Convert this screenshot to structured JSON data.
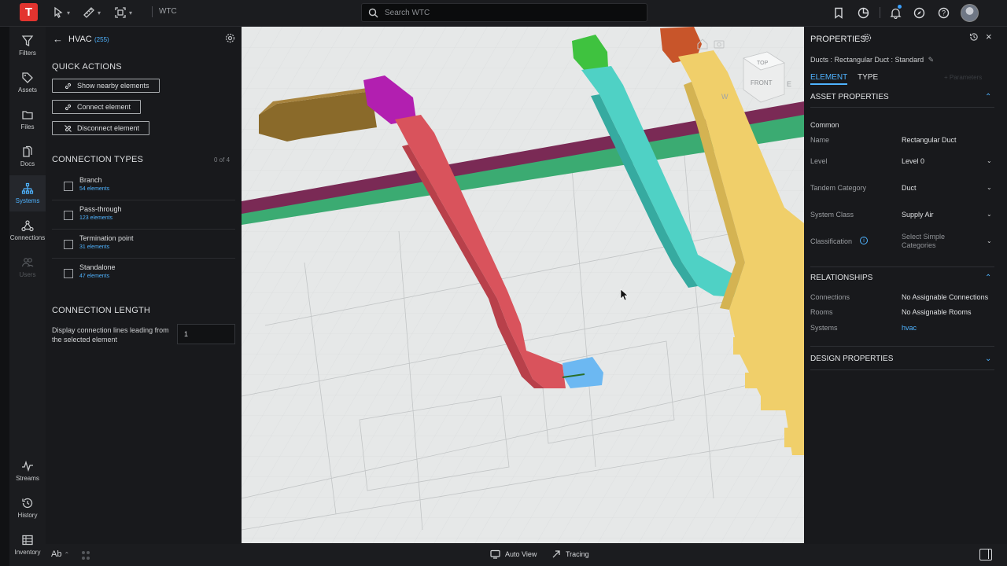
{
  "topbar": {
    "logo": "T",
    "project": "WTC",
    "search_placeholder": "Search WTC"
  },
  "rail": {
    "items": [
      {
        "label": "Filters",
        "icon": "filter-icon"
      },
      {
        "label": "Assets",
        "icon": "tag-icon"
      },
      {
        "label": "Files",
        "icon": "folder-icon"
      },
      {
        "label": "Docs",
        "icon": "docs-icon"
      },
      {
        "label": "Systems",
        "icon": "systems-icon"
      },
      {
        "label": "Connections",
        "icon": "connections-icon"
      },
      {
        "label": "Users",
        "icon": "users-icon"
      }
    ],
    "bottom": [
      {
        "label": "Streams",
        "icon": "streams-icon"
      },
      {
        "label": "History",
        "icon": "history-icon"
      },
      {
        "label": "Inventory",
        "icon": "inventory-icon"
      }
    ]
  },
  "left_panel": {
    "title": "HVAC",
    "count": "(255)",
    "quick_actions_title": "QUICK ACTIONS",
    "quick_actions": [
      "Show nearby elements",
      "Connect element",
      "Disconnect element"
    ],
    "connection_types_title": "CONNECTION TYPES",
    "connection_types_count": "0 of 4",
    "connection_types": [
      {
        "name": "Branch",
        "count": "54 elements"
      },
      {
        "name": "Pass-through",
        "count": "123 elements"
      },
      {
        "name": "Termination point",
        "count": "31 elements"
      },
      {
        "name": "Standalone",
        "count": "47 elements"
      }
    ],
    "connection_length_title": "CONNECTION LENGTH",
    "connection_length_label": "Display connection lines leading from the selected element",
    "connection_length_value": "1"
  },
  "viewcube": {
    "top": "TOP",
    "front": "FRONT",
    "west": "W",
    "east": "E"
  },
  "properties": {
    "title": "PROPERTIES",
    "element_type": "Ducts : Rectangular Duct : Standard",
    "tabs": [
      "ELEMENT",
      "TYPE"
    ],
    "parameters_link": "+ Parameters",
    "asset_properties_title": "ASSET PROPERTIES",
    "common_title": "Common",
    "fields": [
      {
        "key": "Name",
        "value": "Rectangular Duct"
      },
      {
        "key": "Level",
        "value": "Level 0"
      },
      {
        "key": "Tandem Category",
        "value": "Duct"
      },
      {
        "key": "System Class",
        "value": "Supply Air"
      },
      {
        "key": "Classification",
        "value": "Select Simple Categories"
      }
    ],
    "relationships_title": "RELATIONSHIPS",
    "relationships": [
      {
        "key": "Connections",
        "value": "No Assignable Connections"
      },
      {
        "key": "Rooms",
        "value": "No Assignable Rooms"
      },
      {
        "key": "Systems",
        "value": "hvac"
      }
    ],
    "design_properties_title": "DESIGN PROPERTIES"
  },
  "bottombar": {
    "font_toggle": "Ab",
    "auto_view": "Auto View",
    "tracing": "Tracing"
  },
  "colors": {
    "accent": "#4fb3ff",
    "brand": "#e3342f",
    "duct_red": "#d9535c",
    "duct_cyan": "#4fd1c5",
    "duct_yellow": "#f0cf6a",
    "duct_olive": "#8a6a2a",
    "duct_magenta": "#b21fb0",
    "duct_green": "#3fc23f",
    "duct_orange": "#c8552a",
    "pipe_green": "#3bab72",
    "pipe_purple": "#7a2a55",
    "selected_blue": "#6cb8f2"
  }
}
